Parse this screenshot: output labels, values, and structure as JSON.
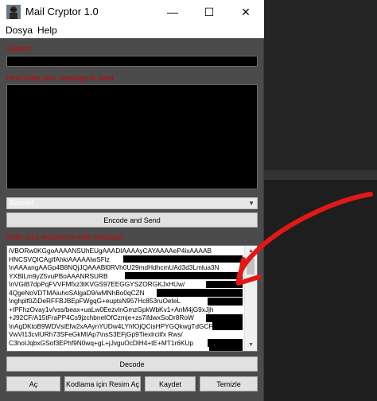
{
  "window": {
    "title": "Mail Cryptor 1.0",
    "icon": "user-avatar-icon",
    "controls": {
      "minimize": "—",
      "maximize": "☐",
      "close": "✕"
    }
  },
  "menu": {
    "items": [
      "Dosya",
      "Help"
    ]
  },
  "subject": {
    "label": "Subject:",
    "value": ""
  },
  "message": {
    "label": "Here Enter your message to send",
    "value": ""
  },
  "encoding": {
    "selected": "Base64"
  },
  "buttons": {
    "encode_send": "Encode and Send",
    "decode": "Decode",
    "open": "Aç",
    "image_for_encoding": "Kodlama için Resim Aç",
    "save": "Kaydet",
    "clear": "Temizle"
  },
  "encoded": {
    "label": "Enter your encoded e-mail message!",
    "lines": [
      "iVBORw0KGgoAAAANSUhEUgAAADIAAAAyCAYAAAAeP4ixAAAAB",
      "HNCSVQICAgIfAhkiAAAAAlwSFlz",
      "\\nAAAangAAGp4B8NQjJQAAABl0RVh0U29mdHdhcmUAd3d3Lmlua3N",
      "YXBlLm9yZ5vuPBoAAANRSURB",
      "\\nVGiB7dpPqFVVFMfxz3tKVGS97EEGGYSZORGKJxHUw/",
      "4QgeNoVDTMAiuhoSAlgaD9/wMNhBo0qCZN",
      "\\nghplf0ZiDeRFFBJBEpFWgqG+euptsN957Hc853ruOeteL",
      "+IPFhzOvay1v/vss/beax+uaLw0EezvlnGmzGpkWbKv1+AnM4jG9xJjh",
      "+J92CF/A15tFraPP4Cs9jzchbnelOfCzmje+zs7ifdwxSoDr8RoW",
      "\\nAgDKtoB9WDVsiEfw2xAAynYUDw4LYhfOjQCisHPYGQkwgTdGCFC2",
      "VwVI13cvlURh73SFeGkMIAp7\\nsS3EFjGp9Tiexlrciifx Rws/",
      "C3hoIJqbxGSof3EPhf9N0wq+gL+jJvguOcDlH4+tE+MT1r6KUp"
    ]
  },
  "colors": {
    "label_red": "#d40000",
    "window_bg": "#4b4b4b",
    "annotation_arrow": "#e01818"
  }
}
